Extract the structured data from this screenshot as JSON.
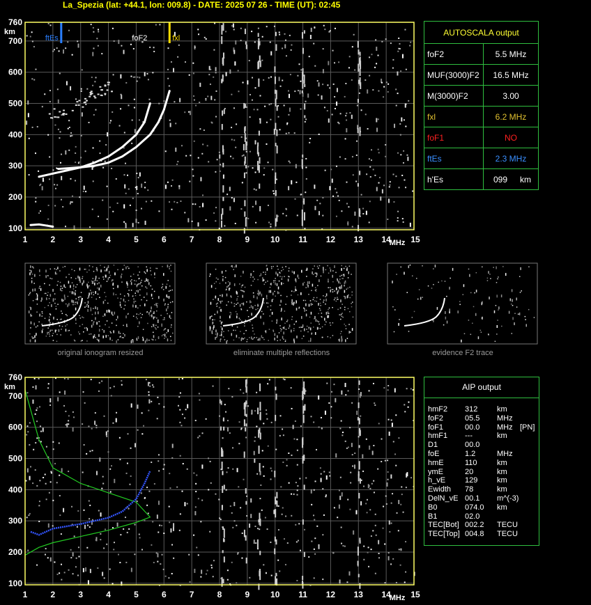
{
  "header": {
    "title": "La_Spezia (lat: +44.1, lon: 009.8) - DATE: 2025 07 26 - TIME (UT): 02:45"
  },
  "colors": {
    "axis": "#ffff66",
    "grid": "#5a5a5a",
    "fxl_marker": "#ffdd00",
    "ftes_marker": "#2a7fff",
    "panel_border": "#2fbf3f",
    "profile_curve": "#22cc22",
    "trace_fit": "#3355ff"
  },
  "autoscala": {
    "heading": "AUTOSCALA output",
    "rows": [
      {
        "label": "foF2",
        "value": "5.5 MHz",
        "color": "#ffffff"
      },
      {
        "label": "MUF(3000)F2",
        "value": "16.5 MHz",
        "color": "#ffffff"
      },
      {
        "label": "M(3000)F2",
        "value": "3.00",
        "color": "#ffffff"
      },
      {
        "label": "fxl",
        "value": "6.2 MHz",
        "color": "#e0c030"
      },
      {
        "label": "foF1",
        "value": "NO",
        "color": "#ff2020"
      },
      {
        "label": "ftEs",
        "value": "2.3 MHz",
        "color": "#3a8fff"
      }
    ],
    "hes": {
      "label": "h'Es",
      "value": "099",
      "unit": "km"
    }
  },
  "top_chart": {
    "markers": [
      {
        "label": "ftEs",
        "freq": 2.3,
        "color": "#2a7fff"
      },
      {
        "label": "foF2",
        "freq": 5.5,
        "color": "#ffffff"
      },
      {
        "label": "fxl",
        "freq": 6.2,
        "color": "#ffdd00"
      }
    ],
    "y_unit": "km",
    "x_unit": "MHz"
  },
  "thumbnails": [
    {
      "caption": "original ionogram resized"
    },
    {
      "caption": "eliminate multiple reflections"
    },
    {
      "caption": "evidence F2 trace"
    }
  ],
  "aip": {
    "heading": "AIP output",
    "rows": [
      {
        "k": "hmF2",
        "v": "312",
        "u": "km",
        "x": ""
      },
      {
        "k": "foF2",
        "v": "05.5",
        "u": "MHz",
        "x": ""
      },
      {
        "k": "foF1",
        "v": "00.0",
        "u": "MHz",
        "x": "[PN]"
      },
      {
        "k": "hmF1",
        "v": "---",
        "u": "km",
        "x": ""
      },
      {
        "k": "D1",
        "v": "00.0",
        "u": "",
        "x": ""
      },
      {
        "k": "foE",
        "v": "1.2",
        "u": "MHz",
        "x": ""
      },
      {
        "k": "hmE",
        "v": "110",
        "u": "km",
        "x": ""
      },
      {
        "k": "ymE",
        "v": "20",
        "u": "km",
        "x": ""
      },
      {
        "k": "h_vE",
        "v": "129",
        "u": "km",
        "x": ""
      },
      {
        "k": "Ewidth",
        "v": "78",
        "u": "km",
        "x": ""
      },
      {
        "k": "DelN_vE",
        "v": "00.1",
        "u": "m^(-3)",
        "x": ""
      },
      {
        "k": "B0",
        "v": "074.0",
        "u": "km",
        "x": ""
      },
      {
        "k": "B1",
        "v": "02.0",
        "u": "",
        "x": ""
      },
      {
        "k": "TEC[Bot]",
        "v": "002.2",
        "u": "TECU",
        "x": ""
      },
      {
        "k": "TEC[Top]",
        "v": "004.8",
        "u": "TECU",
        "x": ""
      }
    ]
  },
  "chart_data": [
    {
      "type": "scatter",
      "name": "ionogram with autoscaling markers",
      "xlabel": "MHz",
      "ylabel": "km",
      "xlim": [
        1,
        15
      ],
      "ylim": [
        95,
        760
      ],
      "x_ticks": [
        1,
        2,
        3,
        4,
        5,
        6,
        7,
        8,
        9,
        10,
        11,
        12,
        13,
        14,
        15
      ],
      "y_ticks": [
        100,
        200,
        300,
        400,
        500,
        600,
        700,
        760
      ],
      "series": [
        {
          "name": "ordinary trace",
          "x": [
            1.5,
            2.0,
            2.5,
            3.0,
            3.5,
            4.0,
            4.5,
            5.0,
            5.3,
            5.5
          ],
          "y": [
            265,
            275,
            285,
            295,
            310,
            330,
            360,
            400,
            440,
            500
          ]
        },
        {
          "name": "extraordinary trace",
          "x": [
            2.2,
            3.0,
            3.5,
            4.0,
            4.5,
            5.0,
            5.5,
            5.8,
            6.0,
            6.2
          ],
          "y": [
            290,
            295,
            300,
            310,
            330,
            360,
            400,
            440,
            480,
            540
          ]
        },
        {
          "name": "Es trace",
          "x": [
            1.2,
            1.5,
            1.8,
            2.0
          ],
          "y": [
            110,
            112,
            108,
            105
          ]
        },
        {
          "name": "multiple echoes",
          "x": [
            2.0,
            2.5,
            3.0,
            3.3,
            3.5,
            3.8,
            4.0
          ],
          "y": [
            470,
            480,
            500,
            520,
            530,
            545,
            555
          ]
        }
      ],
      "markers": [
        {
          "name": "ftEs",
          "x": 2.3
        },
        {
          "name": "foF2",
          "x": 5.5
        },
        {
          "name": "fxl",
          "x": 6.2
        }
      ]
    },
    {
      "type": "line",
      "name": "ionogram with AIP profile",
      "xlabel": "MHz",
      "ylabel": "km",
      "xlim": [
        1,
        15
      ],
      "ylim": [
        95,
        760
      ],
      "x_ticks": [
        1,
        2,
        3,
        4,
        5,
        6,
        7,
        8,
        9,
        10,
        11,
        12,
        13,
        14,
        15
      ],
      "y_ticks": [
        100,
        200,
        300,
        400,
        500,
        600,
        700,
        760
      ],
      "series": [
        {
          "name": "electron density profile",
          "x": [
            1.0,
            1.5,
            2.0,
            3.0,
            4.0,
            5.0,
            5.5,
            5.0,
            4.0,
            3.0,
            2.0,
            1.5,
            1.0
          ],
          "y": [
            190,
            215,
            230,
            250,
            270,
            295,
            312,
            360,
            390,
            420,
            470,
            560,
            720
          ]
        },
        {
          "name": "fitted trace",
          "x": [
            1.2,
            1.5,
            2.0,
            3.0,
            4.0,
            4.5,
            5.0,
            5.3,
            5.5
          ],
          "y": [
            265,
            255,
            275,
            290,
            310,
            330,
            370,
            420,
            460
          ]
        }
      ]
    }
  ]
}
